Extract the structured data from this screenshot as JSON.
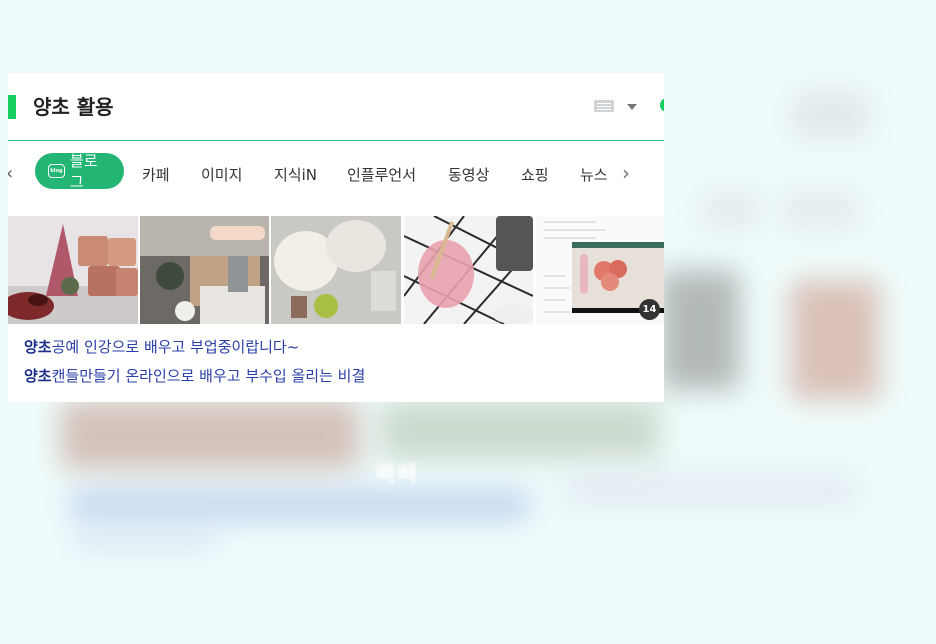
{
  "search": {
    "title": "양초 활용"
  },
  "tabs": {
    "active": "블로그",
    "blog_icon_text": "blog",
    "items": [
      "카페",
      "이미지",
      "지식iN",
      "인플루언서",
      "동영상",
      "쇼핑",
      "뉴스"
    ],
    "prev_arrow": "‹",
    "next_arrow": "›"
  },
  "thumbnails": {
    "count_badge": "14"
  },
  "results": [
    {
      "highlight": "양초",
      "text": "공예 인강으로 배우고 부업중이랍니다~"
    },
    {
      "highlight": "양초",
      "text": "캔들만들기 온라인으로 배우고 부수입 올리는 비결"
    }
  ],
  "background": {
    "watermark": "빠빠"
  },
  "colors": {
    "accent_green": "#19ce60",
    "active_tab": "#22b573",
    "link_blue": "#2a3faa",
    "page_bg": "#effcfb"
  },
  "icons": [
    "keyboard-icon",
    "caret-down-icon",
    "blog-icon",
    "chevron-left-icon",
    "chevron-right-icon"
  ]
}
